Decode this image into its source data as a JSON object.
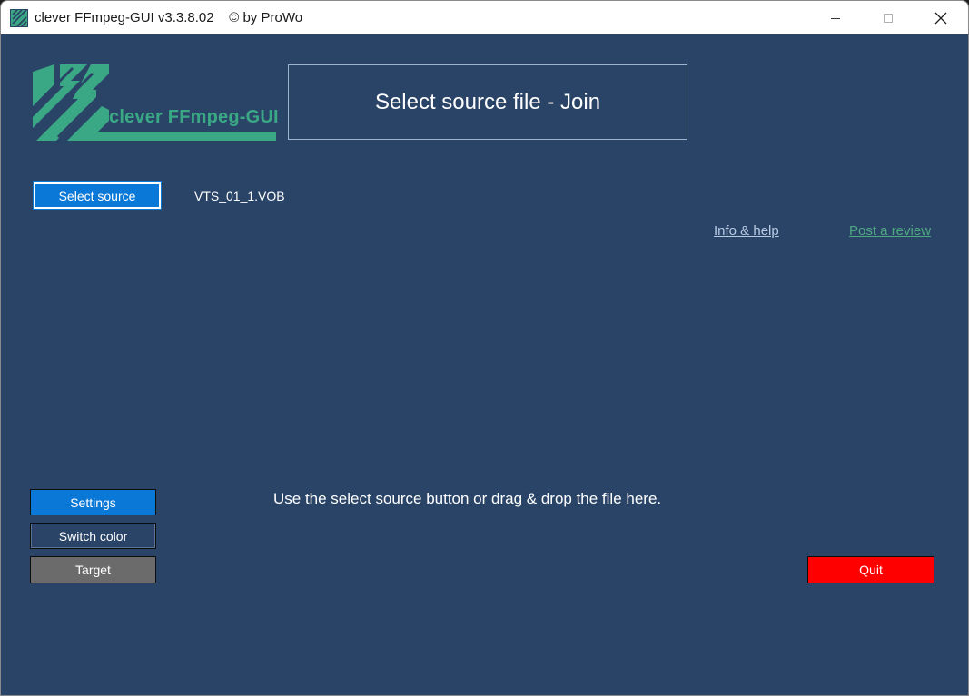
{
  "window": {
    "title": "clever FFmpeg-GUI v3.3.8.02    © by ProWo",
    "minimize_icon": "minimize-icon",
    "maximize_icon": "maximize-icon",
    "close_icon": "close-icon"
  },
  "header": {
    "logo_text": "clever FFmpeg-GUI",
    "headline": "Select source file - Join"
  },
  "source": {
    "select_label": "Select source",
    "filename": "VTS_01_1.VOB"
  },
  "links": {
    "info_help": "Info & help",
    "post_review": "Post a review"
  },
  "main": {
    "drop_hint": "Use the select source button or drag & drop the file here."
  },
  "buttons": {
    "settings": "Settings",
    "switch_color": "Switch color",
    "target": "Target",
    "quit": "Quit"
  },
  "colors": {
    "background": "#2a4467",
    "accent_blue": "#0a78d7",
    "brand_green": "#3aa884",
    "quit_red": "#ff0000",
    "target_gray": "#6b6b6b",
    "info_link": "#b9cbe4",
    "review_link": "#4ea882"
  }
}
